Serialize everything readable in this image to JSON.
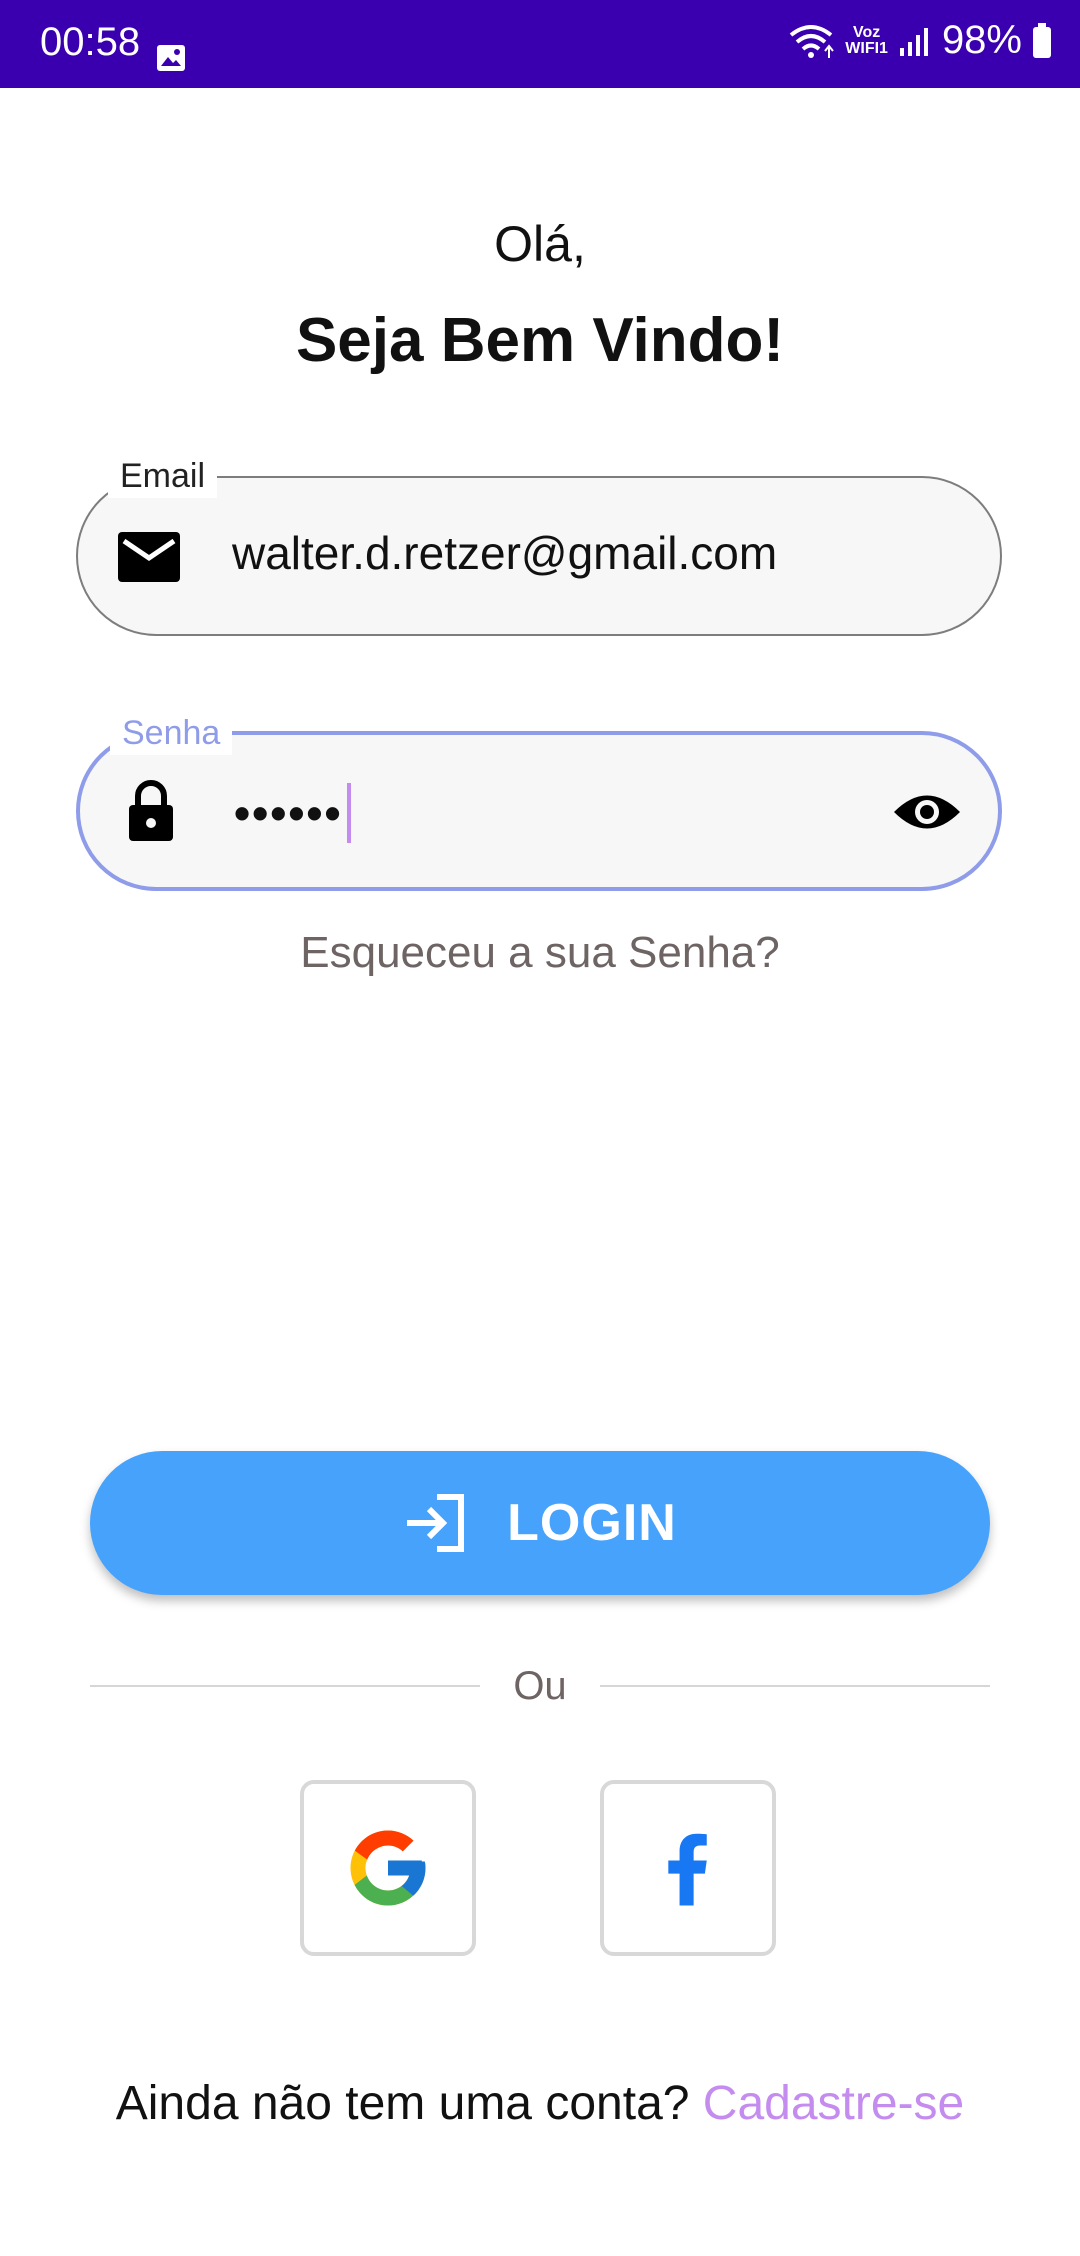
{
  "status_bar": {
    "time": "00:58",
    "network_label": "Voz\nWIFI1",
    "battery": "98%"
  },
  "greeting": {
    "line1": "Olá,",
    "line2": "Seja Bem Vindo!"
  },
  "email_field": {
    "label": "Email",
    "value": "walter.d.retzer@gmail.com",
    "icon": "mail-icon"
  },
  "password_field": {
    "label": "Senha",
    "value": "••••••",
    "icon": "lock-icon",
    "toggle_icon": "eye-icon"
  },
  "forgot_password": "Esqueceu a sua Senha?",
  "login_button": {
    "label": "LOGIN",
    "icon": "login-icon"
  },
  "divider_text": "Ou",
  "social": [
    {
      "name": "Google",
      "icon": "google-icon"
    },
    {
      "name": "Facebook",
      "icon": "facebook-icon"
    }
  ],
  "signup": {
    "prompt": "Ainda não tem uma conta?",
    "link": "Cadastre-se"
  },
  "colors": {
    "status_bar": "#3a00b0",
    "primary_button": "#47a2fb",
    "focus_border": "#8f9ce9",
    "accent_link": "#c58cf0"
  }
}
